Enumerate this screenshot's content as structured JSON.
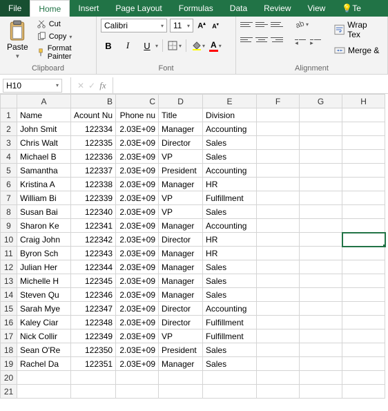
{
  "tabs": {
    "file": "File",
    "home": "Home",
    "insert": "Insert",
    "pagelayout": "Page Layout",
    "formulas": "Formulas",
    "data": "Data",
    "review": "Review",
    "view": "View",
    "tell": "Te"
  },
  "ribbon": {
    "clipboard": {
      "paste": "Paste",
      "cut": "Cut",
      "copy": "Copy",
      "format_painter": "Format Painter",
      "group": "Clipboard"
    },
    "font": {
      "name": "Calibri",
      "size": "11",
      "b": "B",
      "i": "I",
      "u": "U",
      "a_inc": "A",
      "a_dec": "A",
      "a_color": "A",
      "group": "Font"
    },
    "alignment": {
      "wrap": "Wrap Tex",
      "merge": "Merge &",
      "group": "Alignment"
    }
  },
  "fbar": {
    "namebox": "H10",
    "cancel": "✕",
    "enter": "✓",
    "fx": "fx"
  },
  "columns": [
    "A",
    "B",
    "C",
    "D",
    "E",
    "F",
    "G",
    "H"
  ],
  "headers": {
    "A": "Name",
    "B": "Acount Nu",
    "C": "Phone nu",
    "D": "Title",
    "E": "Division"
  },
  "rows": [
    {
      "n": "1"
    },
    {
      "n": "2",
      "A": "John Smit",
      "B": "122334",
      "C": "2.03E+09",
      "D": "Manager",
      "E": "Accounting"
    },
    {
      "n": "3",
      "A": "Chris Walt",
      "B": "122335",
      "C": "2.03E+09",
      "D": "Director",
      "E": "Sales"
    },
    {
      "n": "4",
      "A": "Michael B",
      "B": "122336",
      "C": "2.03E+09",
      "D": "VP",
      "E": "Sales"
    },
    {
      "n": "5",
      "A": "Samantha",
      "B": "122337",
      "C": "2.03E+09",
      "D": "President",
      "E": "Accounting"
    },
    {
      "n": "6",
      "A": "Kristina A",
      "B": "122338",
      "C": "2.03E+09",
      "D": "Manager",
      "E": "HR"
    },
    {
      "n": "7",
      "A": "William Bi",
      "B": "122339",
      "C": "2.03E+09",
      "D": "VP",
      "E": "Fulfillment"
    },
    {
      "n": "8",
      "A": "Susan Bai",
      "B": "122340",
      "C": "2.03E+09",
      "D": "VP",
      "E": "Sales"
    },
    {
      "n": "9",
      "A": "Sharon Ke",
      "B": "122341",
      "C": "2.03E+09",
      "D": "Manager",
      "E": "Accounting"
    },
    {
      "n": "10",
      "A": "Craig John",
      "B": "122342",
      "C": "2.03E+09",
      "D": "Director",
      "E": "HR"
    },
    {
      "n": "11",
      "A": "Byron Sch",
      "B": "122343",
      "C": "2.03E+09",
      "D": "Manager",
      "E": "HR"
    },
    {
      "n": "12",
      "A": "Julian Her",
      "B": "122344",
      "C": "2.03E+09",
      "D": "Manager",
      "E": "Sales"
    },
    {
      "n": "13",
      "A": "Michelle H",
      "B": "122345",
      "C": "2.03E+09",
      "D": "Manager",
      "E": "Sales"
    },
    {
      "n": "14",
      "A": "Steven Qu",
      "B": "122346",
      "C": "2.03E+09",
      "D": "Manager",
      "E": "Sales"
    },
    {
      "n": "15",
      "A": "Sarah Mye",
      "B": "122347",
      "C": "2.03E+09",
      "D": "Director",
      "E": "Accounting"
    },
    {
      "n": "16",
      "A": "Kaley Ciar",
      "B": "122348",
      "C": "2.03E+09",
      "D": "Director",
      "E": "Fulfillment"
    },
    {
      "n": "17",
      "A": "Nick Collir",
      "B": "122349",
      "C": "2.03E+09",
      "D": "VP",
      "E": "Fulfillment"
    },
    {
      "n": "18",
      "A": "Sean O'Re",
      "B": "122350",
      "C": "2.03E+09",
      "D": "President",
      "E": "Sales"
    },
    {
      "n": "19",
      "A": "Rachel Da",
      "B": "122351",
      "C": "2.03E+09",
      "D": "Manager",
      "E": "Sales"
    },
    {
      "n": "20"
    },
    {
      "n": "21"
    }
  ],
  "selected": {
    "row": 10,
    "col": "H"
  }
}
